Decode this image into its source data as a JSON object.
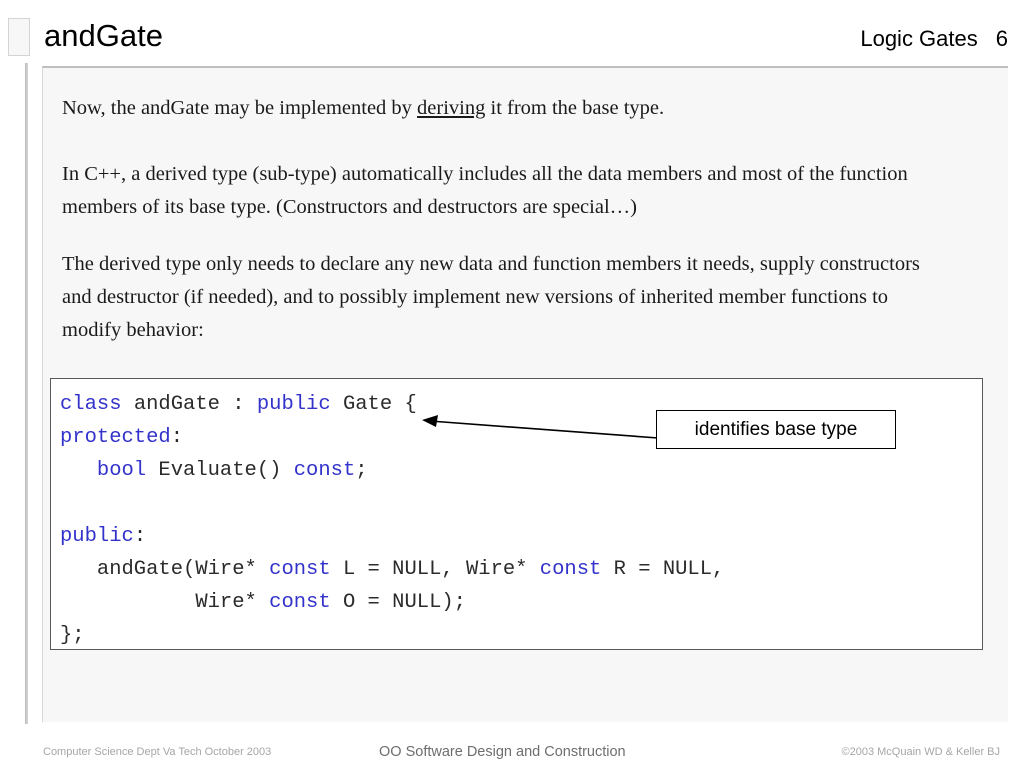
{
  "header": {
    "title": "andGate",
    "subject": "Logic Gates",
    "slide_number": "6",
    "placeholder_icon": "empty-placeholder-box"
  },
  "body": {
    "paragraph_1_before": "Now, the andGate may be implemented by ",
    "paragraph_1_underlined": "deriving",
    "paragraph_1_after": " it from the base type.",
    "paragraph_2": "In C++, a derived type (sub-type) automatically includes all the data members and most of the function members of its base type.  (Constructors and destructors are special…)",
    "paragraph_3": "The derived type only needs to declare any new data and function members it needs, supply constructors and destructor (if needed), and to possibly implement new versions of inherited member functions to modify behavior:"
  },
  "code": {
    "language": "C++",
    "keyword_color": "#3333cc",
    "text_color": "#2b2b2b",
    "lines": [
      {
        "tokens": [
          {
            "t": "class",
            "kw": true
          },
          {
            "t": " andGate : ",
            "kw": false
          },
          {
            "t": "public",
            "kw": true
          },
          {
            "t": " Gate {",
            "kw": false
          }
        ]
      },
      {
        "tokens": [
          {
            "t": "protected",
            "kw": true
          },
          {
            "t": ":",
            "kw": false
          }
        ]
      },
      {
        "tokens": [
          {
            "t": "   ",
            "kw": false
          },
          {
            "t": "bool",
            "kw": true
          },
          {
            "t": " Evaluate() ",
            "kw": false
          },
          {
            "t": "const",
            "kw": true
          },
          {
            "t": ";",
            "kw": false
          }
        ]
      },
      {
        "tokens": [
          {
            "t": "",
            "kw": false
          }
        ]
      },
      {
        "tokens": [
          {
            "t": "public",
            "kw": true
          },
          {
            "t": ":",
            "kw": false
          }
        ]
      },
      {
        "tokens": [
          {
            "t": "   andGate(Wire* ",
            "kw": false
          },
          {
            "t": "const",
            "kw": true
          },
          {
            "t": " L = NULL, Wire* ",
            "kw": false
          },
          {
            "t": "const",
            "kw": true
          },
          {
            "t": " R = NULL,",
            "kw": false
          }
        ]
      },
      {
        "tokens": [
          {
            "t": "           Wire* ",
            "kw": false
          },
          {
            "t": "const",
            "kw": true
          },
          {
            "t": " O = NULL);",
            "kw": false
          }
        ]
      },
      {
        "tokens": [
          {
            "t": "};",
            "kw": false
          }
        ]
      }
    ]
  },
  "callout": {
    "label": "identifies base type",
    "arrow_icon": "left-arrow-annotation"
  },
  "footer": {
    "left": "Computer Science Dept Va Tech October 2003",
    "center": "OO Software Design and Construction",
    "right": "©2003  McQuain WD & Keller BJ"
  }
}
